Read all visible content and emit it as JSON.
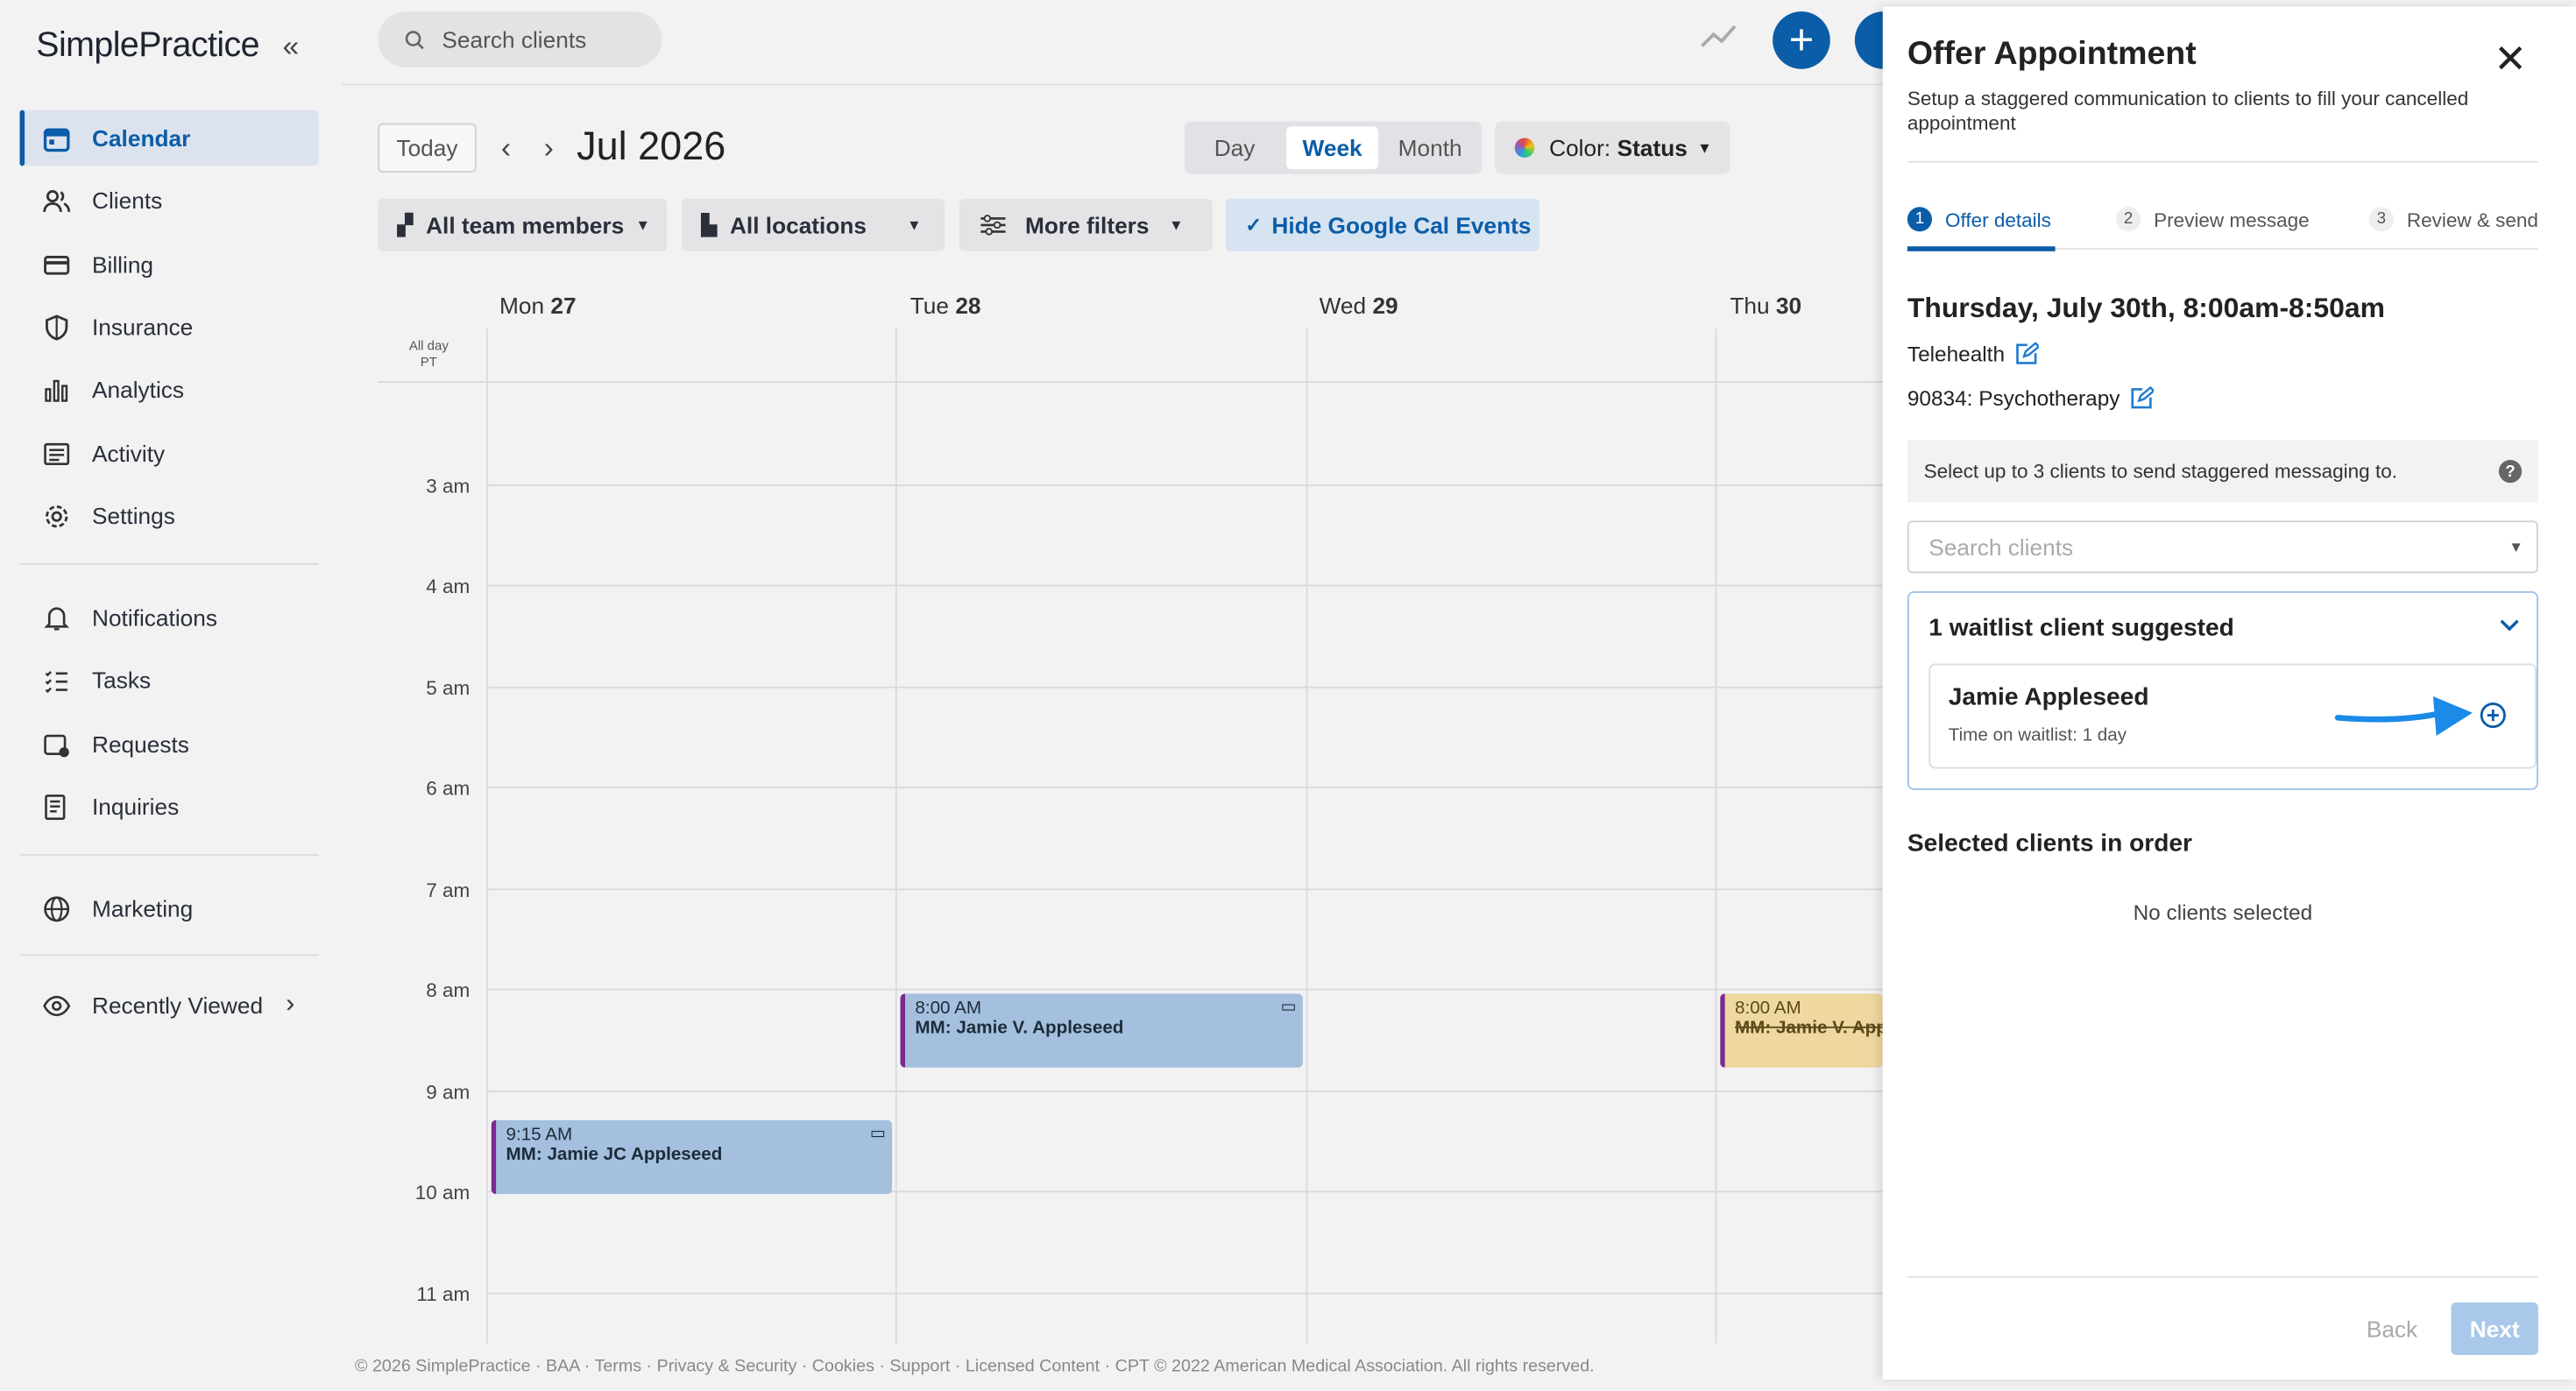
{
  "brand": {
    "logo": "SimplePractice"
  },
  "sidebar": {
    "items": [
      {
        "label": "Calendar",
        "icon": "calendar-icon"
      },
      {
        "label": "Clients",
        "icon": "clients-icon"
      },
      {
        "label": "Billing",
        "icon": "billing-icon"
      },
      {
        "label": "Insurance",
        "icon": "shield-icon"
      },
      {
        "label": "Analytics",
        "icon": "analytics-icon"
      },
      {
        "label": "Activity",
        "icon": "activity-icon"
      },
      {
        "label": "Settings",
        "icon": "gear-icon"
      },
      {
        "label": "Notifications",
        "icon": "bell-icon"
      },
      {
        "label": "Tasks",
        "icon": "tasks-icon"
      },
      {
        "label": "Requests",
        "icon": "requests-icon"
      },
      {
        "label": "Inquiries",
        "icon": "inquiries-icon"
      },
      {
        "label": "Marketing",
        "icon": "globe-icon"
      },
      {
        "label": "Recently Viewed",
        "icon": "eye-icon"
      }
    ]
  },
  "topbar": {
    "search_placeholder": "Search clients"
  },
  "calendar": {
    "today_label": "Today",
    "month_label": "Jul 2026",
    "views": [
      "Day",
      "Week",
      "Month"
    ],
    "active_view": "Week",
    "color_label": "Color:",
    "color_value": "Status",
    "filters": {
      "team": "All team members",
      "locations": "All locations",
      "more": "More filters",
      "google": "Hide Google Cal Events"
    },
    "days": [
      {
        "name": "Mon",
        "date": "27"
      },
      {
        "name": "Tue",
        "date": "28"
      },
      {
        "name": "Wed",
        "date": "29"
      },
      {
        "name": "Thu",
        "date": "30"
      }
    ],
    "allday_label": "All day",
    "tz_label": "PT",
    "hours": [
      "3 am",
      "4 am",
      "5 am",
      "6 am",
      "7 am",
      "8 am",
      "9 am",
      "10 am",
      "11 am"
    ],
    "events": [
      {
        "time": "8:00 AM",
        "title": "MM: Jamie V. Appleseed",
        "day": "Tue"
      },
      {
        "time": "9:15 AM",
        "title": "MM: Jamie JC Appleseed",
        "day": "Mon"
      },
      {
        "time": "8:00 AM",
        "title": "MM: Jamie V. App",
        "day": "Thu",
        "cancelled": true
      }
    ]
  },
  "footer": "© 2026 SimplePractice · BAA · Terms · Privacy & Security · Cookies · Support · Licensed Content · CPT © 2022 American Medical Association. All rights reserved.",
  "panel": {
    "title": "Offer Appointment",
    "subtitle": "Setup a staggered communication to clients to fill your cancelled appointment",
    "steps": [
      {
        "num": "1",
        "label": "Offer details"
      },
      {
        "num": "2",
        "label": "Preview message"
      },
      {
        "num": "3",
        "label": "Review & send"
      }
    ],
    "appt_datetime": "Thursday, July 30th, 8:00am-8:50am",
    "location": "Telehealth",
    "service": "90834: Psychotherapy",
    "info_text": "Select up to 3 clients to send staggered messaging to.",
    "search_placeholder": "Search clients",
    "waitlist_title": "1 waitlist client suggested",
    "waitlist_client": {
      "name": "Jamie Appleseed",
      "time": "Time on waitlist: 1 day"
    },
    "selected_title": "Selected clients in order",
    "no_clients": "No clients selected",
    "back_label": "Back",
    "next_label": "Next"
  },
  "colors": {
    "accent": "#0b5da8",
    "event_blue": "#a4c0de",
    "event_yellow": "#efd7a0",
    "event_border": "#7b2a8f"
  }
}
